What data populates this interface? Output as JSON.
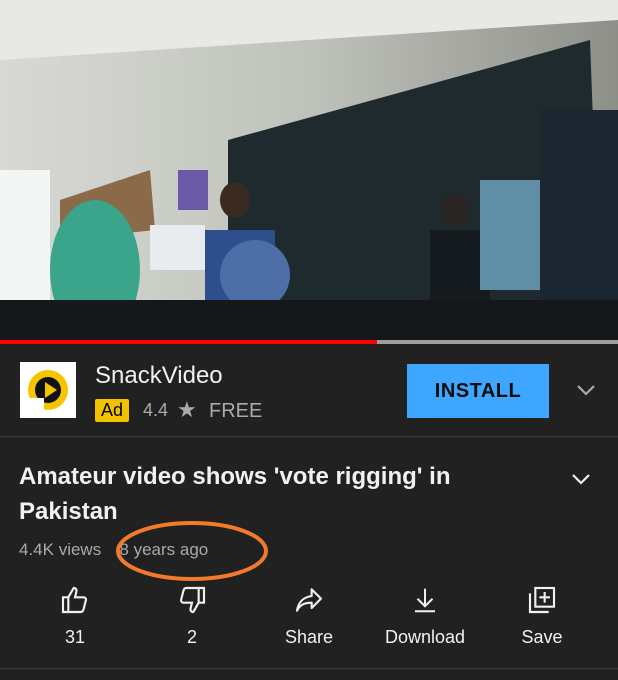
{
  "video": {
    "progress_fraction": 0.61
  },
  "ad": {
    "app_name": "SnackVideo",
    "badge": "Ad",
    "rating": "4.4",
    "star": "★",
    "price": "FREE",
    "install_label": "INSTALL"
  },
  "video_info": {
    "title": "Amateur video shows 'vote rigging' in Pakistan",
    "views": "4.4K views",
    "age": "8 years ago"
  },
  "actions": [
    {
      "label": "31",
      "icon": "thumbs-up-icon"
    },
    {
      "label": "2",
      "icon": "thumbs-down-icon"
    },
    {
      "label": "Share",
      "icon": "share-icon"
    },
    {
      "label": "Download",
      "icon": "download-icon"
    },
    {
      "label": "Save",
      "icon": "save-to-playlist-icon"
    }
  ],
  "colors": {
    "background": "#212121",
    "install_button": "#3ea6ff",
    "ad_badge": "#f2c100",
    "progress": "#ff0000",
    "annotation_circle": "#f47a2a"
  }
}
